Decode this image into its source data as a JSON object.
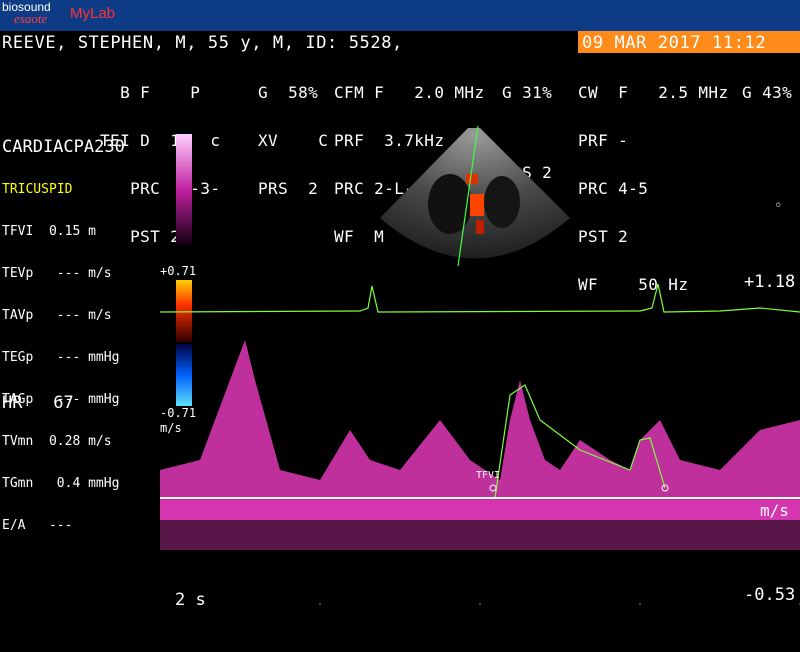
{
  "brand": {
    "line1": "biosound",
    "line2": "esaote",
    "product": "MyLab"
  },
  "patient": {
    "info": "REEVE, STEPHEN, M, 55 y, M, ID: 5528,",
    "datetime": "09 MAR 2017 11:12"
  },
  "header": {
    "col1": [
      "  B F    P",
      "TEI D  17  c",
      "   PRC  5-3-",
      "   PST 2"
    ],
    "col2": [
      "G  58%",
      "XV    C",
      "PRS  2",
      ""
    ],
    "col3": [
      "CFM F   2.0 MHz",
      "PRF  3.7kHz",
      "PRC 2-L-H",
      "WF  M"
    ],
    "col4": [
      "G 31%",
      "",
      "PRS 2",
      ""
    ],
    "col5": [
      "CW  F   2.5 MHz",
      "PRF -",
      "PRC 4-5",
      "PST 2",
      "WF    50 Hz"
    ],
    "col6": [
      "G 43%",
      "",
      "",
      "",
      ""
    ]
  },
  "preset": "CARDIACPA230",
  "measurements": {
    "title": "TRICUSPID",
    "rows": [
      {
        "label": "TFVI",
        "value": " 0.15",
        "unit": "m"
      },
      {
        "label": "TEVp",
        "value": "  ---",
        "unit": "m/s"
      },
      {
        "label": "TAVp",
        "value": "  ---",
        "unit": "m/s"
      },
      {
        "label": "TEGp",
        "value": "  ---",
        "unit": "mmHg"
      },
      {
        "label": "TAGp",
        "value": "  ---",
        "unit": "mmHg"
      },
      {
        "label": "TVmn",
        "value": " 0.28",
        "unit": "m/s"
      },
      {
        "label": "TGmn",
        "value": "  0.4",
        "unit": "mmHg"
      },
      {
        "label": "E/A",
        "value": "  ---",
        "unit": ""
      }
    ]
  },
  "hr": {
    "label": "HR",
    "value": "67"
  },
  "color_scale": {
    "max": "+0.71",
    "min": "-0.71",
    "unit": "m/s"
  },
  "doppler": {
    "top_velocity": "+1.18",
    "bottom_velocity": "-0.53",
    "unit": "m/s",
    "sweep": "2 s",
    "trace_label": "TFVI"
  },
  "colors": {
    "topbar": "#0d3b86",
    "date_bg": "#ff8c1a",
    "spectrum": "#ff40d0",
    "ecg": "#7cff3a",
    "title": "#ffff00"
  }
}
